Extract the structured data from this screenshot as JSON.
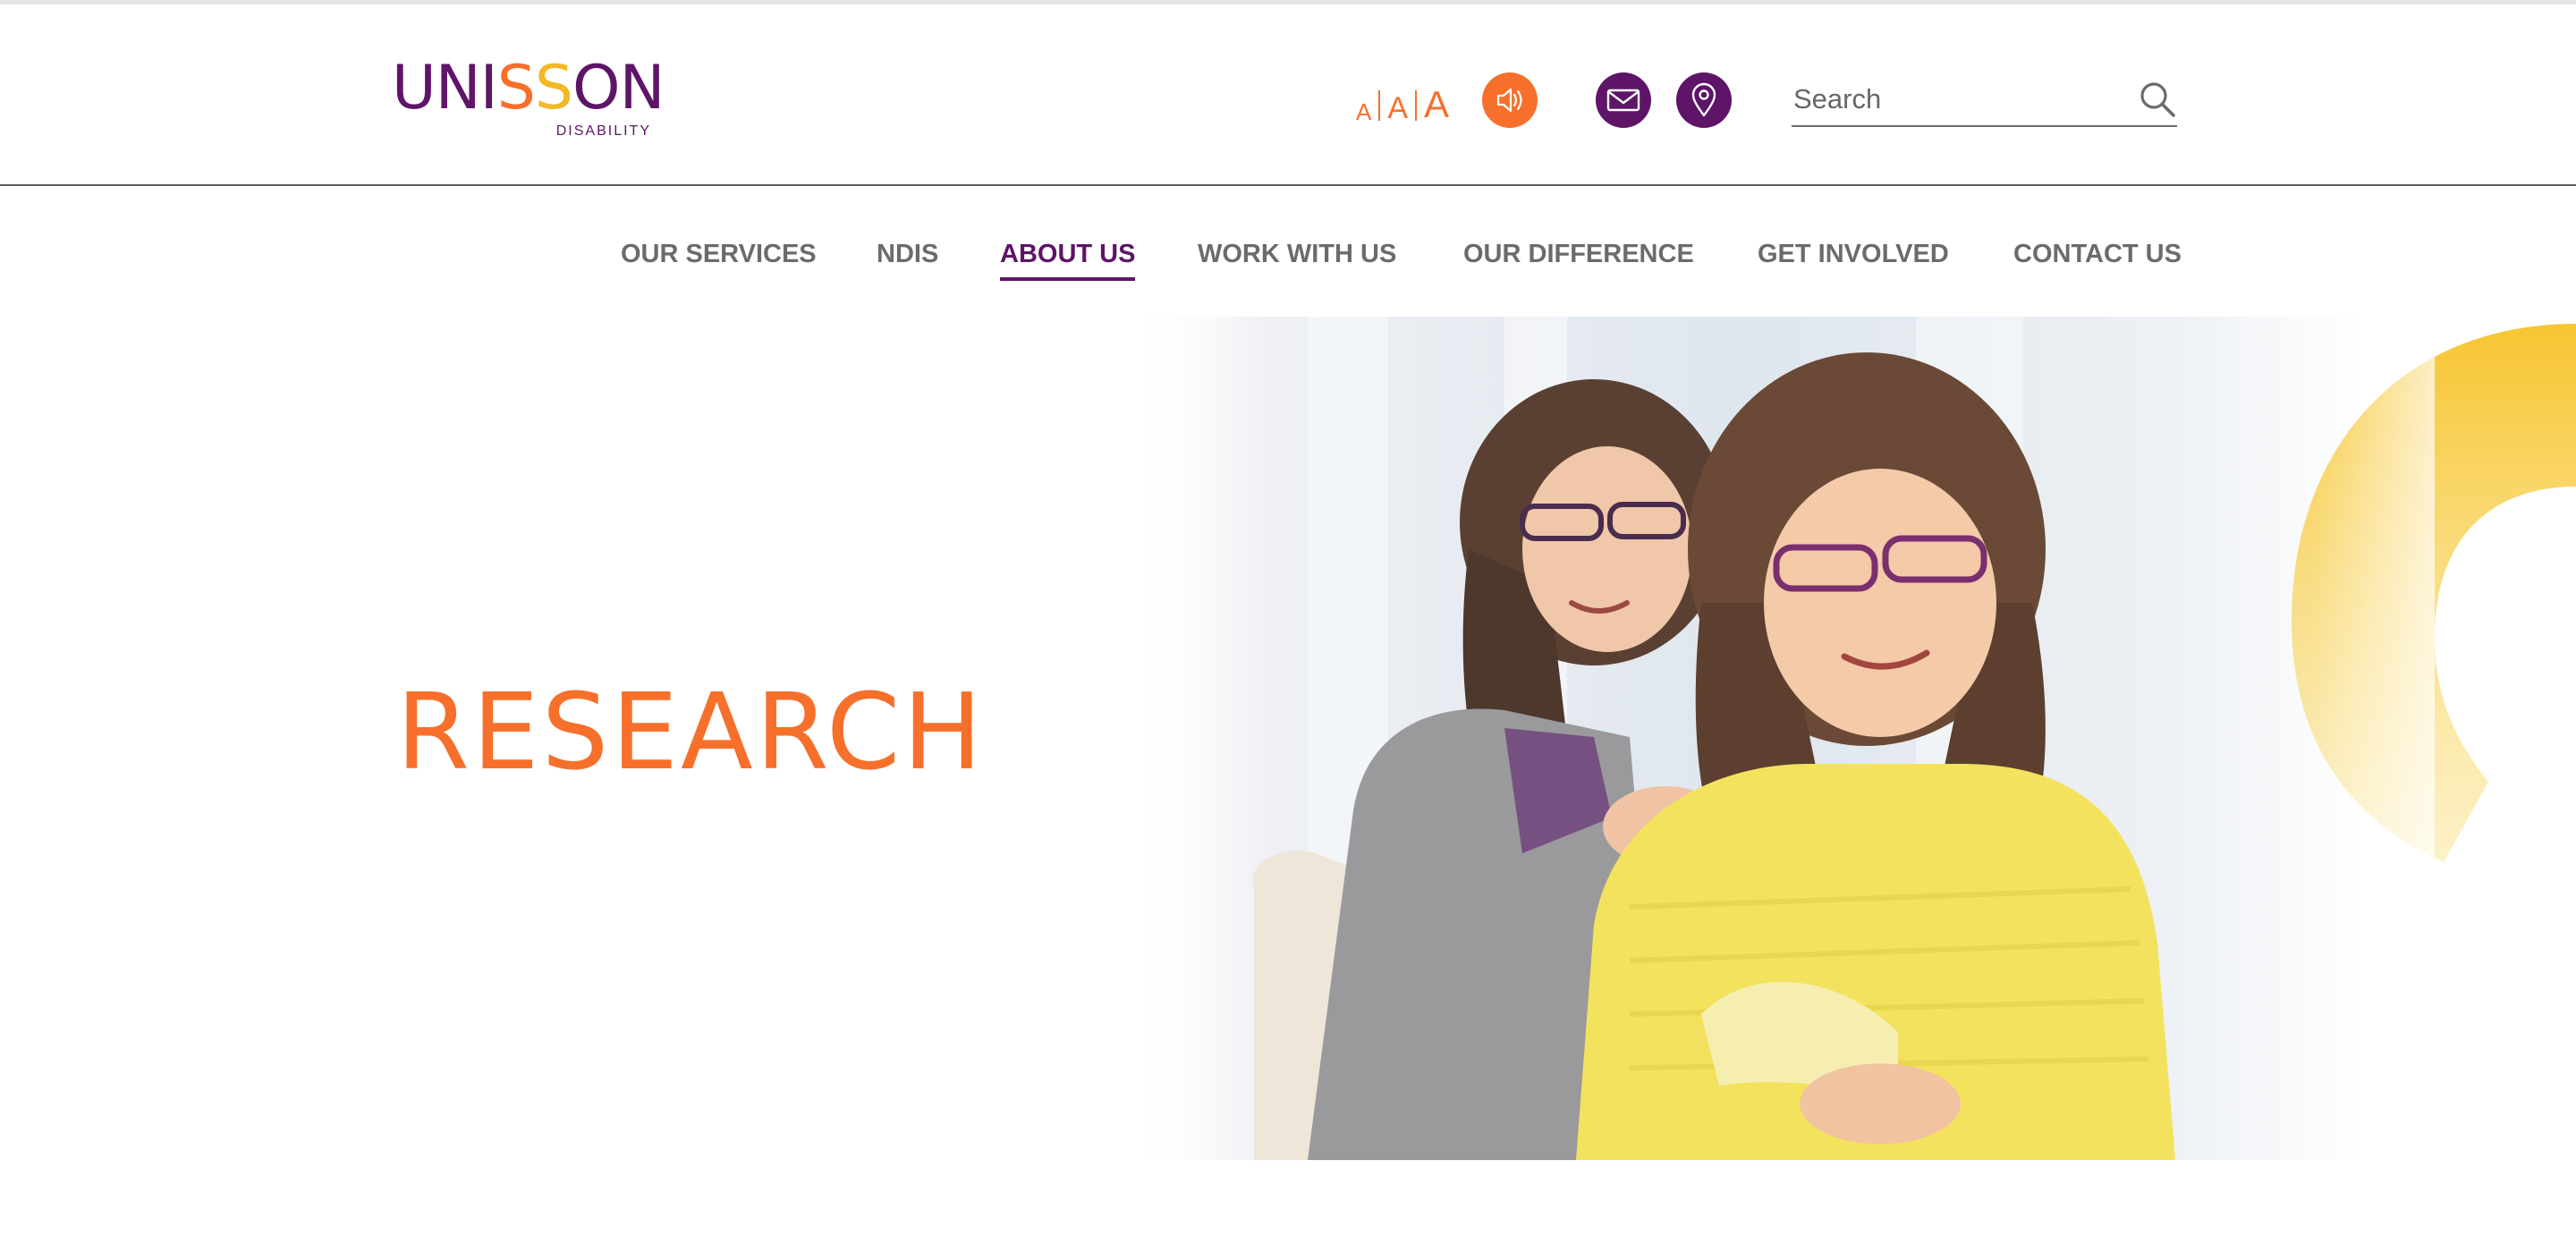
{
  "brand": {
    "logo_letters": [
      "UNI",
      "S",
      "S",
      "ON"
    ],
    "logo_subtitle": "DISABILITY",
    "colors": {
      "purple": "#5e1467",
      "orange": "#f6702b",
      "yellow": "#f2b826"
    }
  },
  "header": {
    "text_size": {
      "small": "A",
      "medium": "A",
      "large": "A"
    },
    "icons": [
      "speaker-icon",
      "mail-icon",
      "location-pin-icon",
      "search-icon"
    ],
    "search": {
      "placeholder": "Search",
      "value": ""
    }
  },
  "nav": {
    "items": [
      {
        "label": "OUR SERVICES"
      },
      {
        "label": "NDIS"
      },
      {
        "label": "ABOUT US",
        "active": true
      },
      {
        "label": "WORK WITH US"
      },
      {
        "label": "OUR DIFFERENCE"
      },
      {
        "label": "GET INVOLVED"
      },
      {
        "label": "CONTACT US"
      }
    ]
  },
  "hero": {
    "title": "RESEARCH"
  }
}
